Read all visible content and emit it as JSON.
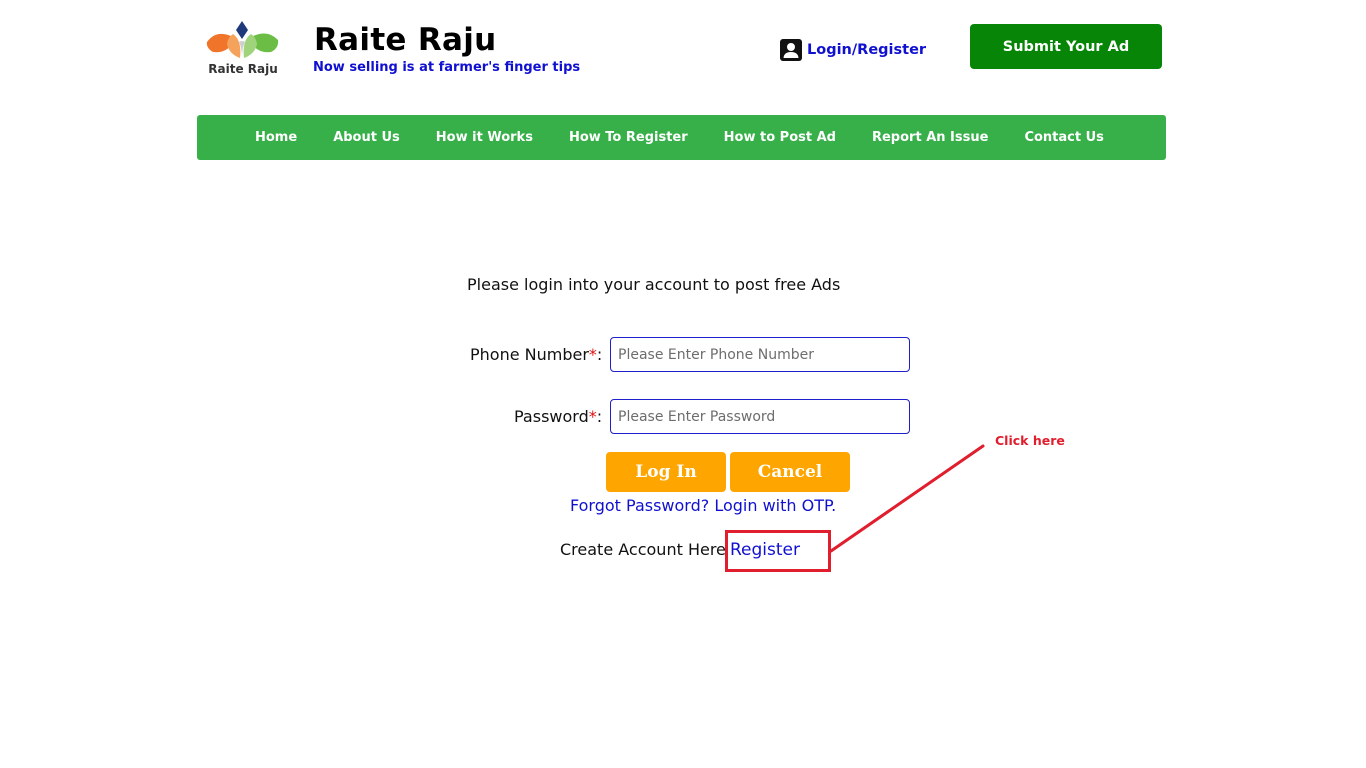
{
  "header": {
    "logo_text": "Raite Raju",
    "site_title": "Raite Raju",
    "tagline": "Now selling is at farmer's finger tips",
    "login_label": "Login",
    "login_separator": "/",
    "register_label": "Register",
    "submit_ad_label": "Submit Your Ad"
  },
  "nav": {
    "items": [
      "Home",
      "About Us",
      "How it Works",
      "How To Register",
      "How to Post Ad",
      "Report An Issue",
      "Contact Us"
    ]
  },
  "form": {
    "intro": "Please login into your account to post free Ads",
    "phone_label": "Phone Number",
    "phone_placeholder": "Please Enter Phone Number",
    "password_label": "Password",
    "password_placeholder": "Please Enter Password",
    "required_marker": "*",
    "label_suffix": ":",
    "login_button": "Log In",
    "cancel_button": "Cancel",
    "forgot_text": "Forgot Password? Login with OTP.",
    "create_text": "Create Account Here",
    "register_link": "Register"
  },
  "annotation": {
    "text": "Click here",
    "color": "#e01e2d"
  },
  "colors": {
    "nav_green": "#37b04a",
    "submit_green": "#078507",
    "button_orange": "#ffa500",
    "link_blue": "#1010d0"
  },
  "icons": [
    "logo-lotus-icon",
    "user-account-icon"
  ]
}
